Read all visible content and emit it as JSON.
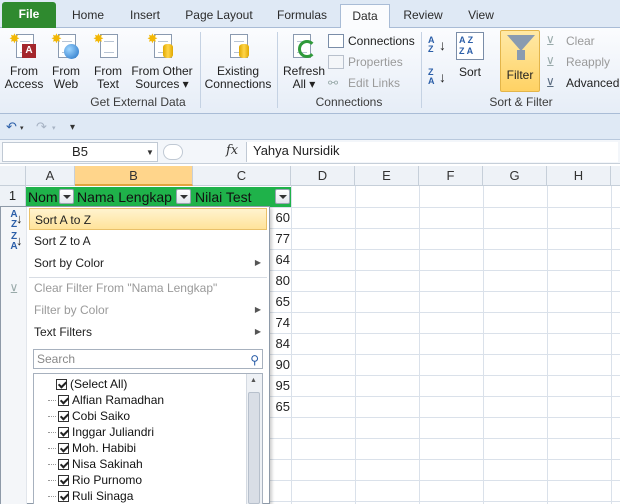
{
  "tabs": [
    "File",
    "Home",
    "Insert",
    "Page Layout",
    "Formulas",
    "Data",
    "Review",
    "View"
  ],
  "active_tab": "Data",
  "ribbon": {
    "get_external_data": {
      "label": "Get External Data",
      "from_access": [
        "From",
        "Access"
      ],
      "from_web": [
        "From",
        "Web"
      ],
      "from_text": [
        "From",
        "Text"
      ],
      "from_other": [
        "From Other",
        "Sources ▾"
      ],
      "existing": [
        "Existing",
        "Connections"
      ]
    },
    "connections": {
      "label": "Connections",
      "refresh": [
        "Refresh",
        "All ▾"
      ],
      "connections": "Connections",
      "properties": "Properties",
      "edit_links": "Edit Links"
    },
    "sort_filter": {
      "label": "Sort & Filter",
      "sort": "Sort",
      "filter": "Filter",
      "clear": "Clear",
      "reapply": "Reapply",
      "advanced": "Advanced"
    }
  },
  "formula_bar": {
    "name_box": "B5",
    "fx": "fx",
    "value": "Yahya Nursidik"
  },
  "columns": [
    "A",
    "B",
    "C",
    "D",
    "E",
    "F",
    "G",
    "H"
  ],
  "header_row": {
    "row_number": "1",
    "a": "Nom",
    "b": "Nama Lengkap",
    "c": "Nilai Test"
  },
  "visible_values": [
    "60",
    "77",
    "64",
    "80",
    "65",
    "74",
    "84",
    "90",
    "95",
    "65"
  ],
  "filter_menu": {
    "sort_az": "Sort A to Z",
    "sort_za": "Sort Z to A",
    "sort_color": "Sort by Color",
    "clear_filter": "Clear Filter From \"Nama Lengkap\"",
    "filter_color": "Filter by Color",
    "text_filters": "Text Filters",
    "search_placeholder": "Search",
    "items": [
      "(Select All)",
      "Alfian Ramadhan",
      "Cobi Saiko",
      "Inggar Juliandri",
      "Moh. Habibi",
      "Nisa Sakinah",
      "Rio Purnomo",
      "Ruli Sinaga"
    ]
  },
  "colors": {
    "header_fill": "#1fb24a",
    "file_tab": "#2f8a2f",
    "selection": "#ffd58b",
    "accent": "#2b5ea8"
  }
}
